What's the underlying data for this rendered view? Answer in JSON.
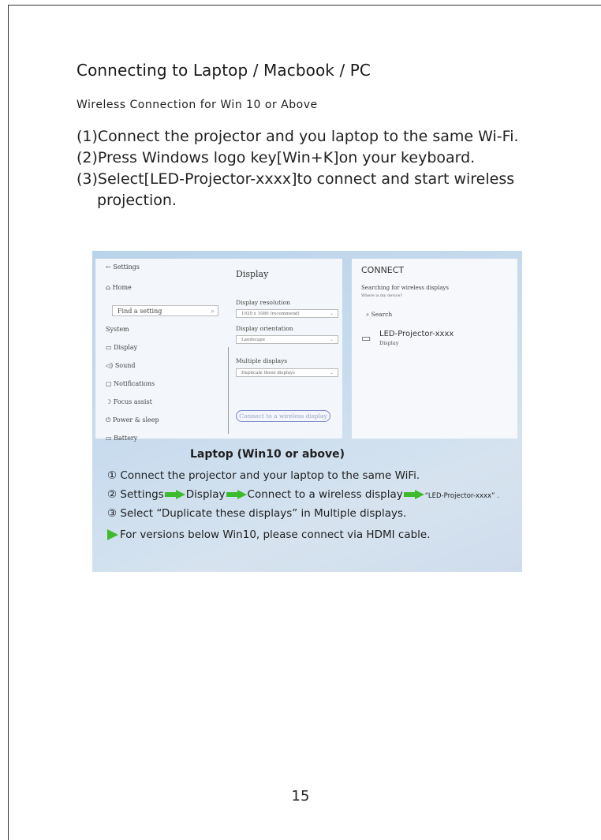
{
  "heading": "Connecting to Laptop / Macbook / PC",
  "subheading": "Wireless Connection for Win 10 or Above",
  "steps": {
    "s1": "(1)Connect the projector and you laptop to the same Wi-Fi.",
    "s2": "(2)Press Windows logo key[Win+K]on your keyboard.",
    "s3a": "(3)Select[LED-Projector-xxxx]to connect and start wireless",
    "s3b": "projection."
  },
  "settings": {
    "back": "← Settings",
    "home": "Home",
    "find": "Find a setting",
    "system": "System",
    "items": [
      "Display",
      "Sound",
      "Notifications",
      "Focus assist",
      "Power & sleep",
      "Battery"
    ],
    "display_title": "Display",
    "resolution_label": "Display resolution",
    "resolution_value": "1920 x 1080 (recommend)",
    "orientation_label": "Display orientation",
    "orientation_value": "Landscape",
    "multiple_label": "Multiple displays",
    "multiple_value": "Duplicate these displays",
    "connect_button": "Connect to a wireless display"
  },
  "connect_panel": {
    "title": "CONNECT",
    "searching": "Searching for wireless displays",
    "where": "Where is my device?",
    "search": "Search",
    "device_name": "LED-Projector-xxxx",
    "device_type": "Display"
  },
  "laptop_title": "Laptop (Win10 or above)",
  "instructions": {
    "i1": "① Connect the projector and your laptop to the same WiFi.",
    "i2_a": "② Settings",
    "i2_b": "Display",
    "i2_c": "Connect to a wireless display",
    "i2_d": "“LED-Projector-xxxx” .",
    "i3": "③ Select  “Duplicate these displays” in Multiple displays.",
    "i4": "For versions below Win10, please connect via HDMI cable."
  },
  "page_number": "15",
  "colors": {
    "arrow": "#3dbb2c",
    "panel_bg": "#c9dcee"
  }
}
